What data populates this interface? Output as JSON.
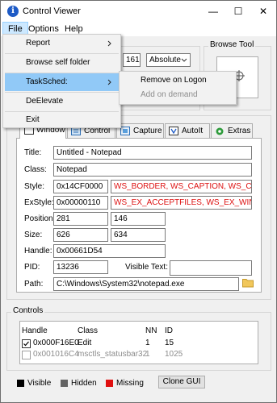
{
  "window": {
    "title": "Control Viewer",
    "icon": "i",
    "minimize": "—",
    "maximize": "☐",
    "close": "✕"
  },
  "menubar": {
    "items": [
      "File",
      "Options",
      "Help"
    ]
  },
  "file_menu": {
    "items": [
      "Report",
      "Browse self folder",
      "TaskSched:",
      "DeElevate",
      "Exit"
    ],
    "submenu": {
      "remove": "Remove on Logon",
      "add": "Add on demand"
    }
  },
  "top_group": {
    "partial_value": "161",
    "mode_select": "Absolute"
  },
  "browse_tool": {
    "label": "Browse Tool"
  },
  "tabs": [
    "Window",
    "Control",
    "Capture",
    "AutoIt",
    "Extras"
  ],
  "window_tab": {
    "title_label": "Title:",
    "title_value": "Untitled - Notepad",
    "class_label": "Class:",
    "class_value": "Notepad",
    "style_label": "Style:",
    "style_value": "0x14CF0000",
    "style_flags": "WS_BORDER, WS_CAPTION, WS_CLIPSIE",
    "exstyle_label": "ExStyle:",
    "exstyle_value": "0x00000110",
    "exstyle_flags": "WS_EX_ACCEPTFILES, WS_EX_WINDOW",
    "position_label": "Position:",
    "pos_x": "281",
    "pos_y": "146",
    "size_label": "Size:",
    "size_w": "626",
    "size_h": "634",
    "handle_label": "Handle:",
    "handle_value": "0x00661D54",
    "pid_label": "PID:",
    "pid_value": "13236",
    "visible_text_label": "Visible Text:",
    "path_label": "Path:",
    "path_value": "C:\\Windows\\System32\\notepad.exe"
  },
  "controls": {
    "label": "Controls",
    "headers": [
      "Handle",
      "Class",
      "NN",
      "ID"
    ],
    "rows": [
      {
        "handle": "0x000F16E0",
        "class": "Edit",
        "nn": "1",
        "id": "15",
        "checked": true
      },
      {
        "handle": "0x001016C4",
        "class": "msctls_statusbar32",
        "nn": "1",
        "id": "1025",
        "checked": false
      }
    ]
  },
  "legend": {
    "visible": "Visible",
    "hidden": "Hidden",
    "missing": "Missing"
  },
  "clone_button": "Clone GUI",
  "colors": {
    "visible": "#000000",
    "hidden": "#646464",
    "missing": "#e01010",
    "highlight": "#91c9f7"
  }
}
